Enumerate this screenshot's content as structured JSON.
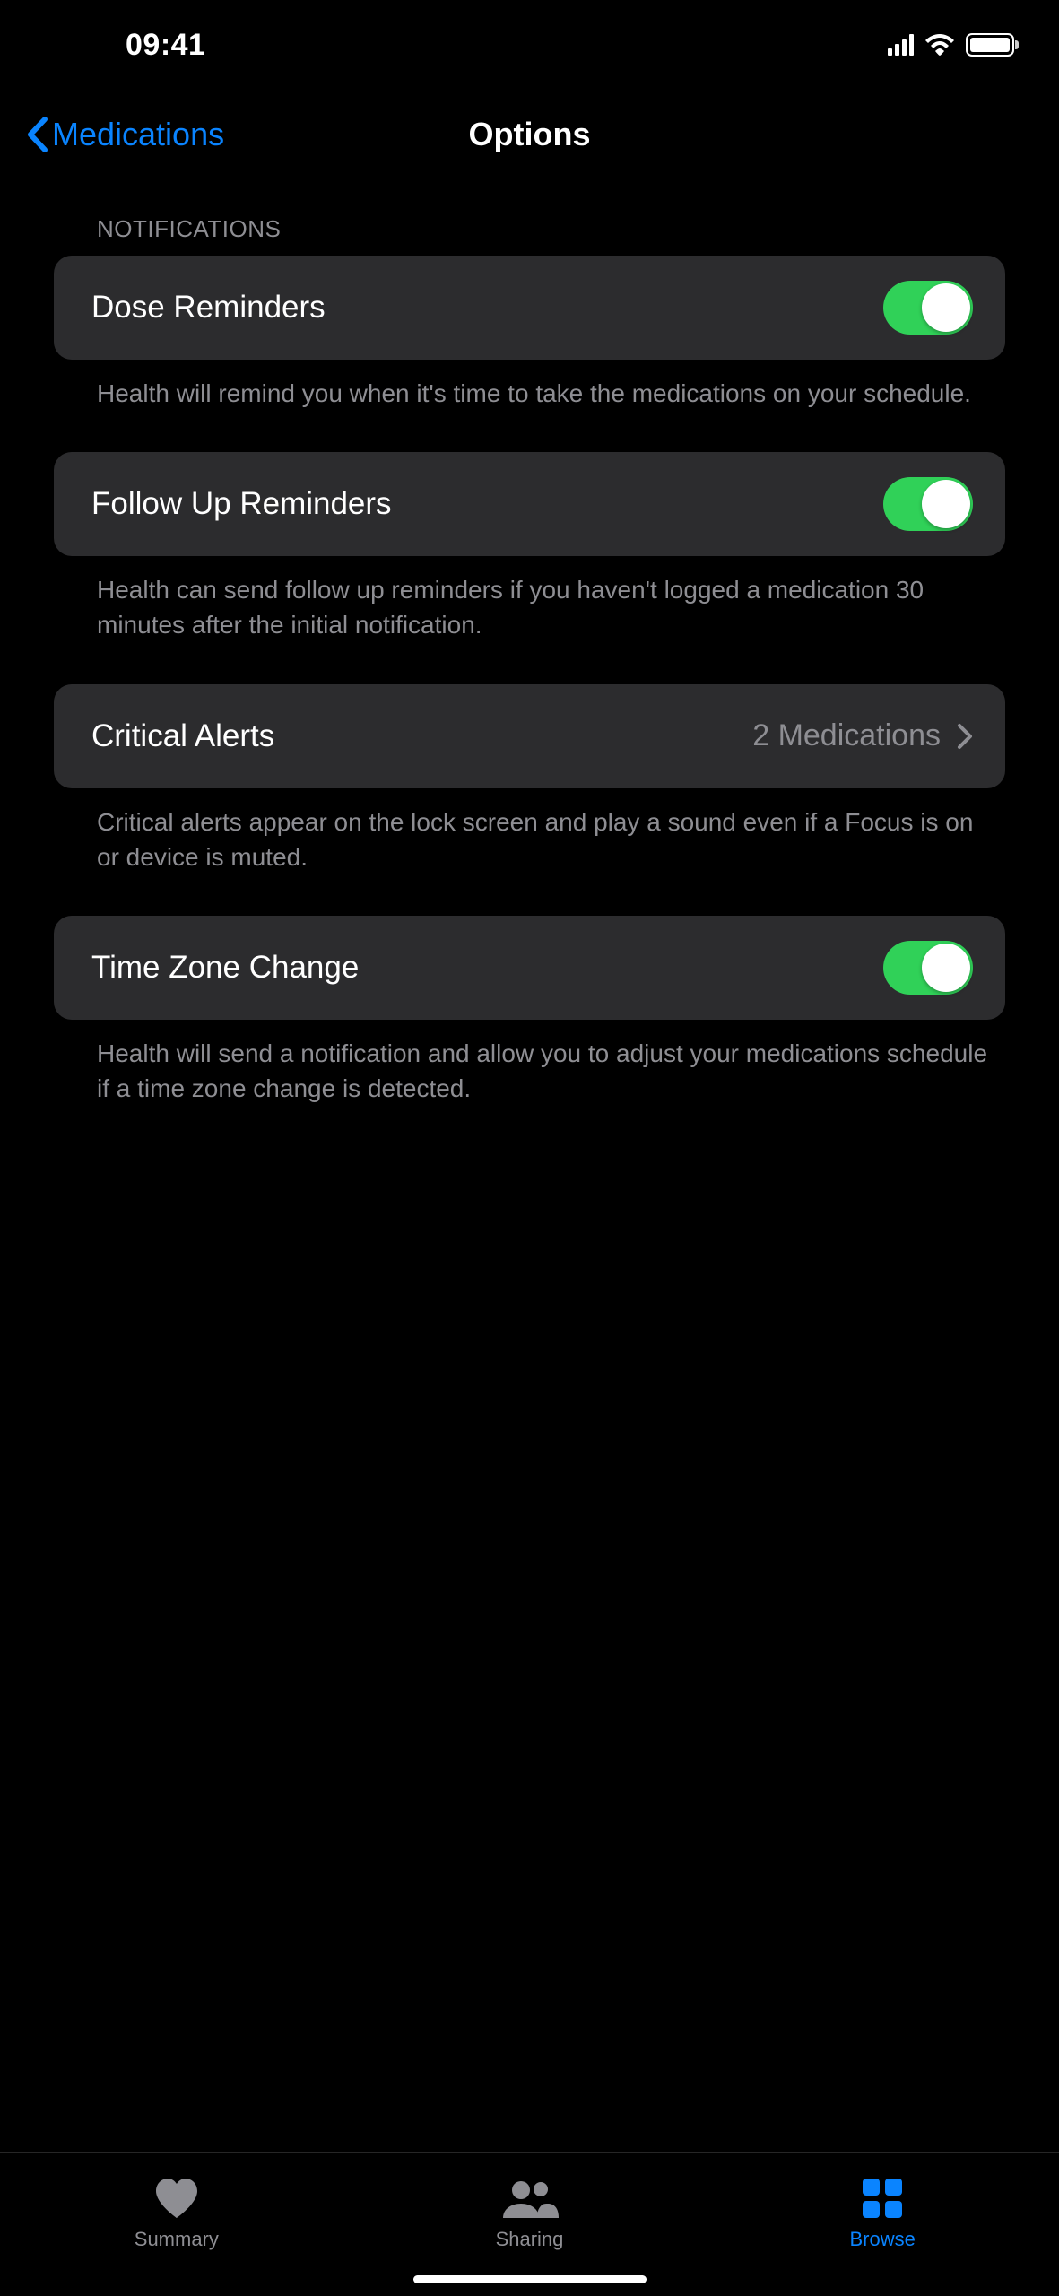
{
  "status": {
    "time": "09:41"
  },
  "nav": {
    "back_label": "Medications",
    "title": "Options"
  },
  "section": {
    "header": "NOTIFICATIONS",
    "rows": {
      "dose": {
        "label": "Dose Reminders",
        "toggle_on": true,
        "footer": "Health will remind you when it's time to take the medications on your schedule."
      },
      "followup": {
        "label": "Follow Up Reminders",
        "toggle_on": true,
        "footer": "Health can send follow up reminders if you haven't logged a medication 30 minutes after the initial notification."
      },
      "critical": {
        "label": "Critical Alerts",
        "detail": "2 Medications",
        "footer": "Critical alerts appear on the lock screen and play a sound even if a Focus is on or device is muted."
      },
      "timezone": {
        "label": "Time Zone Change",
        "toggle_on": true,
        "footer": "Health will send a notification and allow you to adjust your medications schedule if a time zone change is detected."
      }
    }
  },
  "tabbar": {
    "summary": "Summary",
    "sharing": "Sharing",
    "browse": "Browse"
  }
}
